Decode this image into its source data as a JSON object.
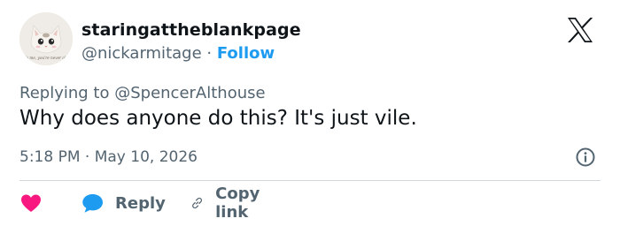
{
  "author": {
    "display_name": "staringattheblankpage",
    "handle": "@nickarmitage",
    "separator": "·",
    "follow_label": "Follow",
    "avatar_caption": "To me, you're never old"
  },
  "replying_to": {
    "prefix": "Replying to",
    "handle": "@SpencerAlthouse"
  },
  "tweet": {
    "text": "Why does anyone do this? It's just vile.",
    "time": "5:18 PM",
    "separator": "·",
    "date": "May 10, 2026"
  },
  "actions": {
    "reply_label": "Reply",
    "copy_link_label": "Copy link"
  },
  "colors": {
    "accent": "#1d9bf0",
    "like": "#f91880",
    "secondary_text": "#536471",
    "primary_text": "#0f1419"
  },
  "icons": [
    "x-logo-icon",
    "info-icon",
    "heart-icon",
    "reply-bubble-icon",
    "link-icon"
  ]
}
